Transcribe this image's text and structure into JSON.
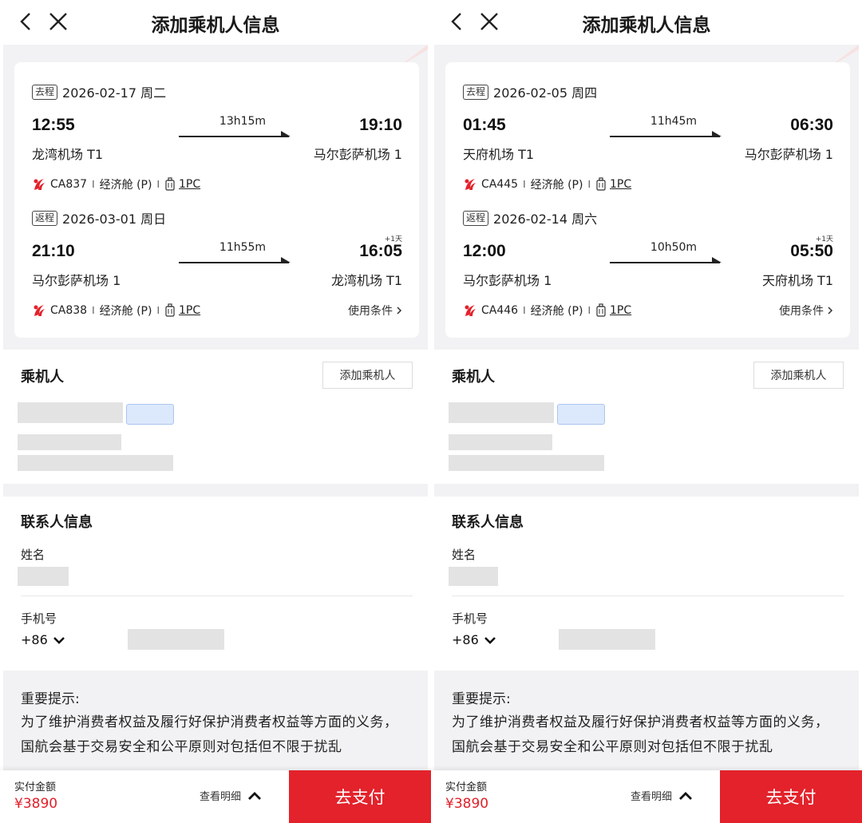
{
  "colors": {
    "brand_red": "#e3222b",
    "price_red": "#e0202a",
    "section_bg": "#f2f2f4"
  },
  "icons": {
    "back": "chevron-left-icon",
    "close": "close-icon",
    "airline": "air-china-logo-icon",
    "baggage": "luggage-icon",
    "conditions": "chevron-right-icon",
    "country_dropdown": "chevron-down-icon",
    "detail": "chevron-up-icon"
  },
  "panels": [
    {
      "header": {
        "title": "添加乘机人信息"
      },
      "outbound": {
        "tag": "去程",
        "date": "2026-02-17 周二",
        "dep_time": "12:55",
        "arr_time": "19:10",
        "duration": "13h15m",
        "plus_day": "",
        "dep_airport": "龙湾机场 T1",
        "arr_airport": "马尔彭萨机场 1",
        "flight": "CA837",
        "cabin": "经济舱 (P)",
        "baggage": "1PC",
        "sep": "I"
      },
      "return": {
        "tag": "返程",
        "date": "2026-03-01 周日",
        "dep_time": "21:10",
        "arr_time": "16:05",
        "duration": "11h55m",
        "plus_day": "+1天",
        "dep_airport": "马尔彭萨机场 1",
        "arr_airport": "龙湾机场 T1",
        "flight": "CA838",
        "cabin": "经济舱 (P)",
        "baggage": "1PC",
        "sep": "I",
        "conditions": "使用条件"
      },
      "passengers": {
        "title": "乘机人",
        "add_button": "添加乘机人"
      },
      "contact": {
        "title": "联系人信息",
        "name_label": "姓名",
        "phone_label": "手机号",
        "country_code": "+86"
      },
      "notice": {
        "title": "重要提示:",
        "body": "为了维护消费者权益及履行好保护消费者权益等方面的义务，国航会基于交易安全和公平原则对包括但不限于扰乱"
      },
      "footer": {
        "total_label": "实付金额",
        "total_value": "¥3890",
        "detail_label": "查看明细",
        "pay_button": "去支付"
      }
    },
    {
      "header": {
        "title": "添加乘机人信息"
      },
      "outbound": {
        "tag": "去程",
        "date": "2026-02-05 周四",
        "dep_time": "01:45",
        "arr_time": "06:30",
        "duration": "11h45m",
        "plus_day": "",
        "dep_airport": "天府机场 T1",
        "arr_airport": "马尔彭萨机场 1",
        "flight": "CA445",
        "cabin": "经济舱 (P)",
        "baggage": "1PC",
        "sep": "I"
      },
      "return": {
        "tag": "返程",
        "date": "2026-02-14 周六",
        "dep_time": "12:00",
        "arr_time": "05:50",
        "duration": "10h50m",
        "plus_day": "+1天",
        "dep_airport": "马尔彭萨机场 1",
        "arr_airport": "天府机场 T1",
        "flight": "CA446",
        "cabin": "经济舱 (P)",
        "baggage": "1PC",
        "sep": "I",
        "conditions": "使用条件"
      },
      "passengers": {
        "title": "乘机人",
        "add_button": "添加乘机人"
      },
      "contact": {
        "title": "联系人信息",
        "name_label": "姓名",
        "phone_label": "手机号",
        "country_code": "+86"
      },
      "notice": {
        "title": "重要提示:",
        "body": "为了维护消费者权益及履行好保护消费者权益等方面的义务，国航会基于交易安全和公平原则对包括但不限于扰乱"
      },
      "footer": {
        "total_label": "实付金额",
        "total_value": "¥3890",
        "detail_label": "查看明细",
        "pay_button": "去支付"
      }
    }
  ]
}
